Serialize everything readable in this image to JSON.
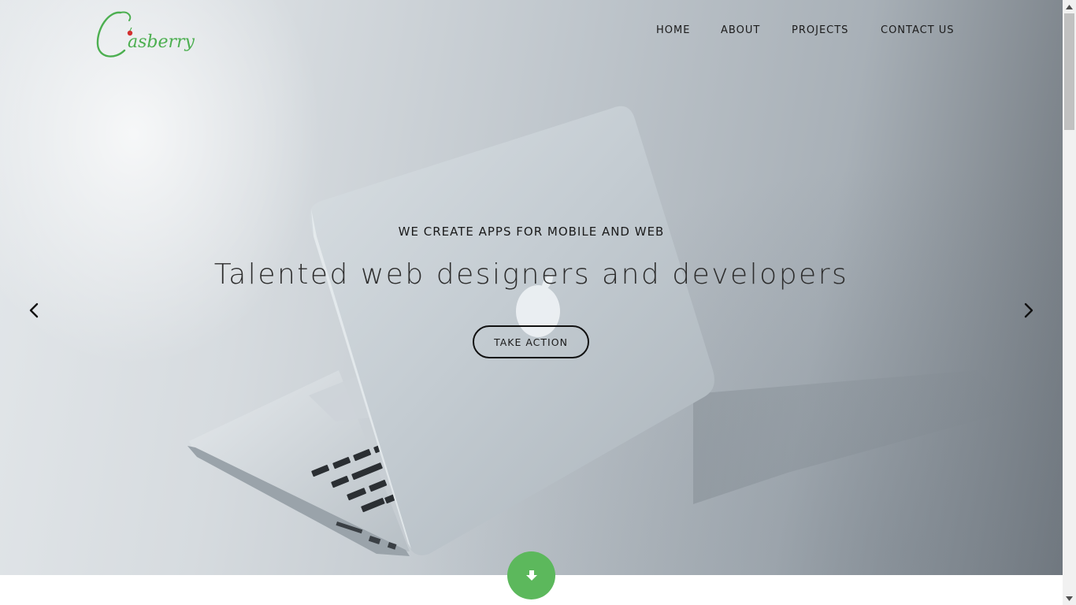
{
  "brand": {
    "name": "Casberry",
    "logo_text": "asberry",
    "color": "#4caf50",
    "accent": "#d32f2f"
  },
  "nav": {
    "items": [
      "HOME",
      "ABOUT",
      "PROJECTS",
      "CONTACT US"
    ]
  },
  "hero": {
    "subtitle": "WE CREATE APPS FOR MOBILE AND WEB",
    "headline": "Talented web designers and developers",
    "cta_label": "TAKE ACTION",
    "prev_icon": "chevron-left-icon",
    "next_icon": "chevron-right-icon",
    "image": "laptop-photo"
  },
  "scroll_down": {
    "icon": "arrow-down-icon",
    "color": "#5cb85c"
  },
  "scrollbar": {
    "icons": [
      "scroll-up-arrow-icon",
      "scroll-down-arrow-icon"
    ]
  }
}
